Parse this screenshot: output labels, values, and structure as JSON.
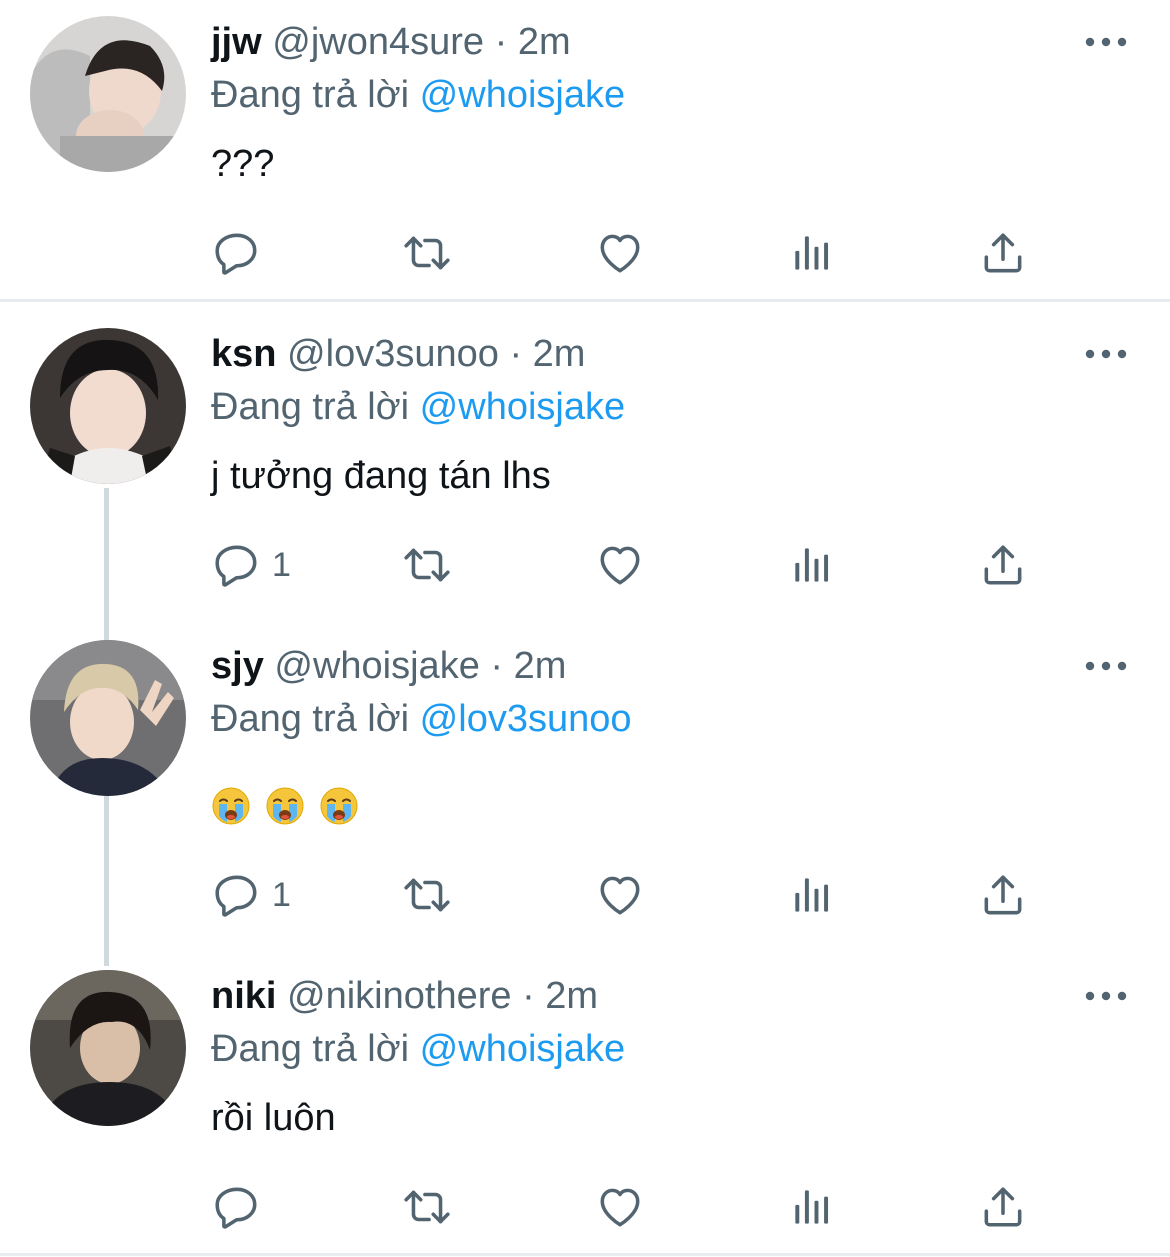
{
  "tweets": [
    {
      "name": "jjw",
      "handle": "@jwon4sure",
      "dot": "·",
      "time": "2m",
      "replying_prefix": "Đang trả lời",
      "replying_to": "@whoisjake",
      "text": "???",
      "reply_count": ""
    },
    {
      "name": "ksn",
      "handle": "@lov3sunoo",
      "dot": "·",
      "time": "2m",
      "replying_prefix": "Đang trả lời",
      "replying_to": "@whoisjake",
      "text": "j tưởng đang tán lhs",
      "reply_count": "1"
    },
    {
      "name": "sjy",
      "handle": "@whoisjake",
      "dot": "·",
      "time": "2m",
      "replying_prefix": "Đang trả lời",
      "replying_to": "@lov3sunoo",
      "text": "",
      "emojis": [
        "loudly-crying-face",
        "loudly-crying-face",
        "loudly-crying-face"
      ],
      "reply_count": "1"
    },
    {
      "name": "niki",
      "handle": "@nikinothere",
      "dot": "·",
      "time": "2m",
      "replying_prefix": "Đang trả lời",
      "replying_to": "@whoisjake",
      "text": "rồi luôn",
      "reply_count": ""
    }
  ],
  "colors": {
    "text": "#0f1419",
    "secondary": "#536471",
    "link": "#1d9bf0",
    "separator": "#e6ecf0",
    "thread_line": "#cfd9de"
  },
  "icons": [
    "reply-icon",
    "retweet-icon",
    "like-icon",
    "analytics-icon",
    "share-icon",
    "more-icon"
  ]
}
